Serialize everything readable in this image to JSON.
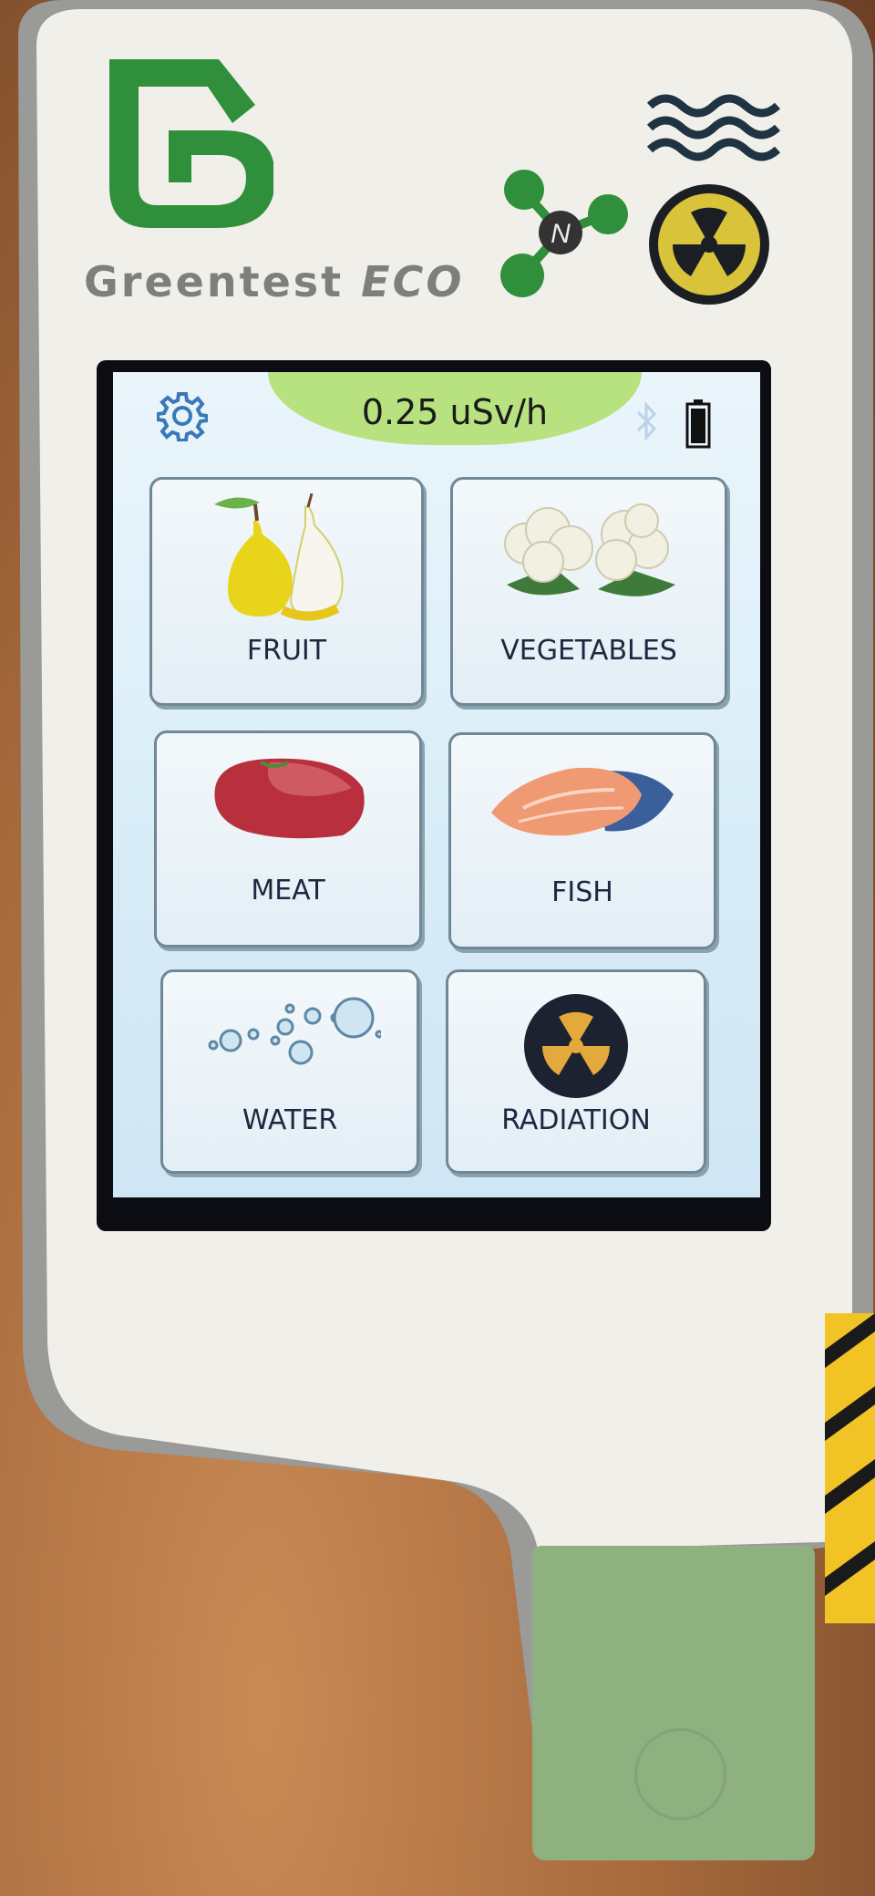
{
  "device": {
    "brand": "Greentest",
    "model": "ECO",
    "body_color": "#f1efe9",
    "accent_green": "#2f8f3a"
  },
  "status_bar": {
    "dose_rate": "0.25 uSv/h",
    "settings_icon": "gear-icon",
    "bluetooth_icon": "bluetooth-icon",
    "battery_icon": "battery-icon"
  },
  "menu": {
    "tiles": [
      {
        "label": "FRUIT",
        "icon": "pear-icon"
      },
      {
        "label": "VEGETABLES",
        "icon": "cauliflower-icon"
      },
      {
        "label": "MEAT",
        "icon": "meat-icon"
      },
      {
        "label": "FISH",
        "icon": "salmon-icon"
      },
      {
        "label": "WATER",
        "icon": "water-drops-icon"
      },
      {
        "label": "RADIATION",
        "icon": "radiation-icon"
      }
    ]
  }
}
